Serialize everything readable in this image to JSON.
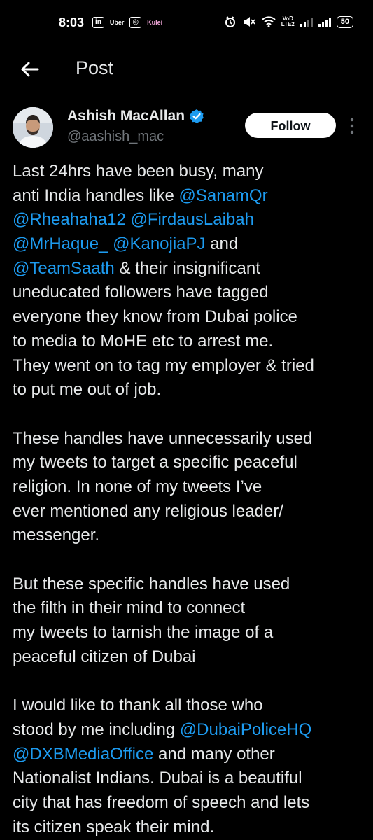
{
  "status_bar": {
    "time": "8:03",
    "apps": [
      "in",
      "Uber",
      "◎",
      "Kulei"
    ],
    "lte": "VoD\nLTE2",
    "battery": "50"
  },
  "top_bar": {
    "title": "Post"
  },
  "author": {
    "name": "Ashish MacAllan",
    "handle": "@aashish_mac",
    "follow_label": "Follow"
  },
  "tweet": {
    "lines": [
      [
        {
          "t": "Last 24hrs have been busy, many"
        }
      ],
      [
        {
          "t": "anti India handles like "
        },
        {
          "t": "@SanamQr",
          "m": true
        }
      ],
      [
        {
          "t": "@Rheahaha12",
          "m": true
        },
        {
          "t": " "
        },
        {
          "t": "@FirdausLaibah",
          "m": true
        }
      ],
      [
        {
          "t": "@MrHaque_",
          "m": true
        },
        {
          "t": " "
        },
        {
          "t": "@KanojiaPJ",
          "m": true
        },
        {
          "t": " and"
        }
      ],
      [
        {
          "t": "@TeamSaath",
          "m": true
        },
        {
          "t": " & their insignificant"
        }
      ],
      [
        {
          "t": "uneducated followers have tagged"
        }
      ],
      [
        {
          "t": "everyone they know from Dubai police"
        }
      ],
      [
        {
          "t": "to media to MoHE etc to arrest me."
        }
      ],
      [
        {
          "t": "They went on to tag my employer & tried"
        }
      ],
      [
        {
          "t": "to put me out of job."
        }
      ],
      [],
      [
        {
          "t": "These handles have unnecessarily used"
        }
      ],
      [
        {
          "t": "my tweets to target a specific peaceful"
        }
      ],
      [
        {
          "t": "religion. In none of my tweets I’ve"
        }
      ],
      [
        {
          "t": "ever mentioned any religious leader/"
        }
      ],
      [
        {
          "t": "messenger."
        }
      ],
      [],
      [
        {
          "t": "But these specific handles have used"
        }
      ],
      [
        {
          "t": "the filth in their mind to connect"
        }
      ],
      [
        {
          "t": "my tweets to tarnish the image of a"
        }
      ],
      [
        {
          "t": "peaceful citizen of Dubai"
        }
      ],
      [],
      [
        {
          "t": "I would like to thank all those who"
        }
      ],
      [
        {
          "t": "stood by me including "
        },
        {
          "t": "@DubaiPoliceHQ",
          "m": true
        }
      ],
      [
        {
          "t": "@DXBMediaOffice",
          "m": true
        },
        {
          "t": " and many other"
        }
      ],
      [
        {
          "t": "Nationalist Indians. Dubai is a beautiful"
        }
      ],
      [
        {
          "t": "city that has freedom of speech and lets"
        }
      ],
      [
        {
          "t": "its citizen speak their mind."
        }
      ]
    ]
  },
  "colors": {
    "background": "#000000",
    "text": "#e7e9ea",
    "mention": "#1d9bf0",
    "secondary": "#71767b",
    "verified": "#1d9bf0"
  }
}
